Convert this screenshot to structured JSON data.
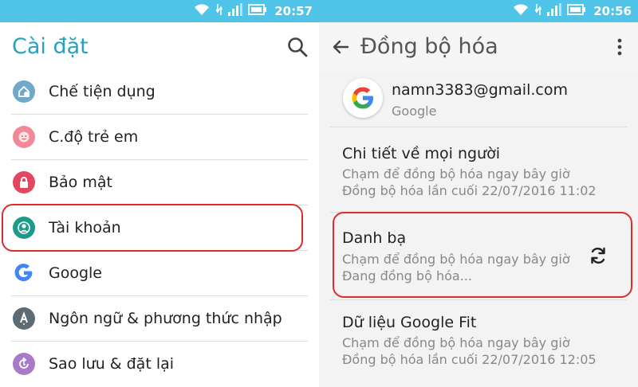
{
  "left": {
    "status_time": "20:57",
    "title": "Cài đặt",
    "items": [
      {
        "label": "Chế tiện dụng",
        "icon": "easy-mode-icon",
        "color": "#6fa9c9"
      },
      {
        "label": "C.độ trẻ em",
        "icon": "kids-mode-icon",
        "color": "#f08a9a"
      },
      {
        "label": "Bảo mật",
        "icon": "lock-icon",
        "color": "#e64560"
      },
      {
        "label": "Tài khoản",
        "icon": "account-icon",
        "color": "#1d9b8a"
      },
      {
        "label": "Google",
        "icon": "google-icon",
        "color": "#4285f4"
      },
      {
        "label": "Ngôn ngữ & phương thức nhập",
        "icon": "language-icon",
        "color": "#5d6b75"
      },
      {
        "label": "Sao lưu & đặt lại",
        "icon": "backup-icon",
        "color": "#a77bc7"
      }
    ]
  },
  "right": {
    "status_time": "20:56",
    "title": "Đồng bộ hóa",
    "account": {
      "email": "namn3383@gmail.com",
      "type": "Google"
    },
    "sync_items": [
      {
        "title": "Chi tiết về mọi người",
        "line1": "Chạm để đồng bộ hóa ngay bây giờ",
        "line2": "Đồng bộ hóa lần cuối 22/07/2016 11:02"
      },
      {
        "title": "Danh bạ",
        "line1": "Chạm để đồng bộ hóa ngay bây giờ",
        "line2": "Đang đồng bộ hóa..."
      },
      {
        "title": "Dữ liệu Google Fit",
        "line1": "Chạm để đồng bộ hóa ngay bây giờ",
        "line2": "Đồng bộ hóa lần cuối 22/07/2016 12:05"
      }
    ]
  },
  "colors": {
    "statusbar": "#4fc3e8",
    "accent": "#22a3c1",
    "highlight": "#e02b2b"
  }
}
